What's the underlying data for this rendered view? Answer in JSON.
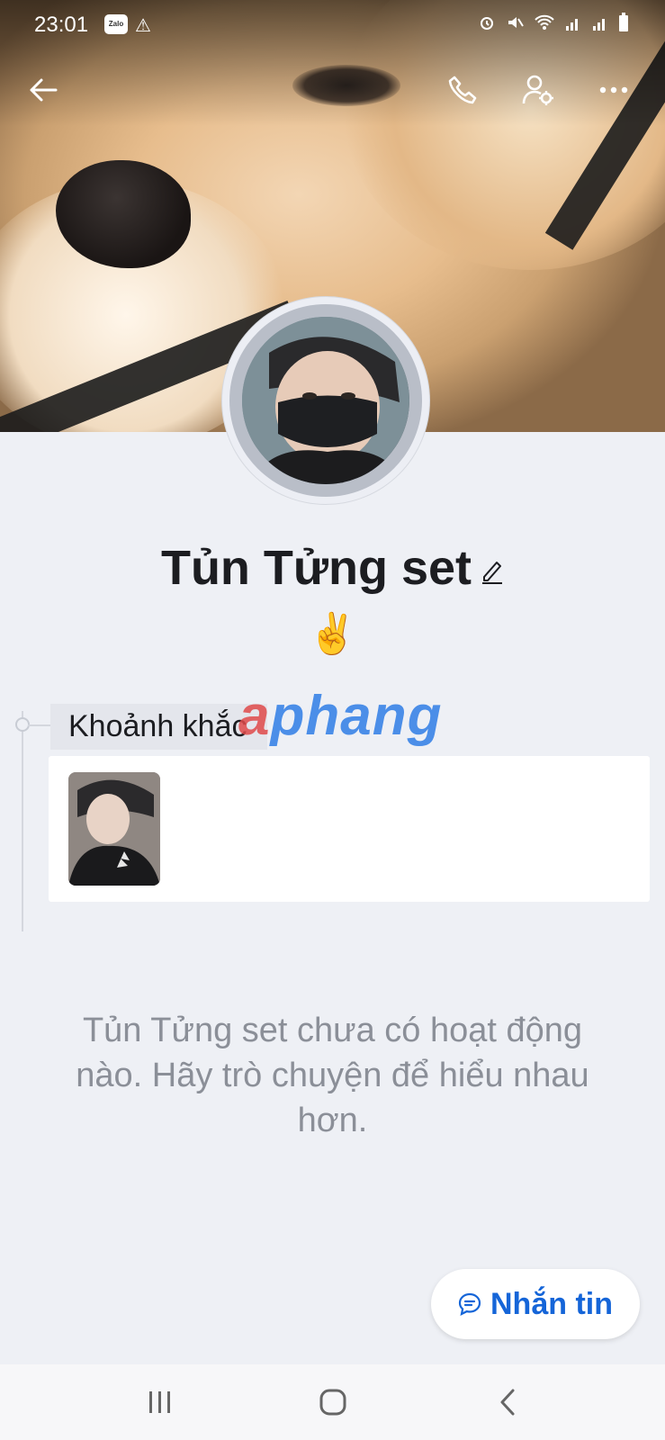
{
  "status_bar": {
    "time": "23:01",
    "zalo_badge": "Zalo",
    "warning_glyph": "⚠",
    "right_icons": [
      "alarm-icon",
      "mute-icon",
      "wifi-icon",
      "signal-icon",
      "signal-icon",
      "battery-icon"
    ]
  },
  "header": {
    "back_icon": "arrow-left-icon",
    "call_icon": "phone-icon",
    "settings_icon": "user-settings-icon",
    "more_icon": "more-dots-icon"
  },
  "profile": {
    "name": "Tủn Tửng set",
    "bio": "✌️"
  },
  "moments": {
    "label": "Khoảnh khắc",
    "item_count": 1
  },
  "watermark": {
    "prefix": "a",
    "text": "phang"
  },
  "empty_message": "Tủn Tửng set chưa có hoạt động nào. Hãy trò chuyện để hiểu nhau hơn.",
  "message_button": {
    "label": "Nhắn tin",
    "color": "#1565d8"
  },
  "nav": {
    "recent_icon": "recent-apps-icon",
    "home_icon": "home-icon",
    "back_icon": "back-chevron-icon"
  }
}
